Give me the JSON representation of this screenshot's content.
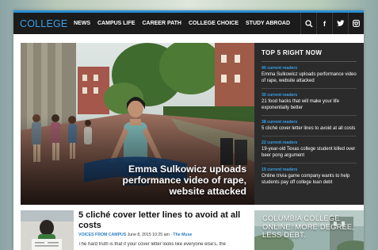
{
  "header": {
    "logo": "COLLEGE",
    "nav": [
      "NEWS",
      "CAMPUS LIFE",
      "CAREER PATH",
      "COLLEGE CHOICE",
      "STUDY ABROAD"
    ],
    "tools": {
      "search_icon": "search-icon",
      "facebook_label": "f",
      "twitter_icon": "twitter-icon",
      "instagram_icon": "instagram-icon"
    }
  },
  "hero": {
    "headline": "Emma Sulkowicz uploads performance video of rape, website attacked"
  },
  "top5": {
    "title": "TOP 5 RIGHT NOW",
    "items": [
      {
        "count": "40 current readers",
        "text": "Emma Sulkowicz uploads performance video of rape, website attacked"
      },
      {
        "count": "30 current readers",
        "text": "21 food hacks that will make your life exponentially better"
      },
      {
        "count": "38 current readers",
        "text": "5 cliché cover letter lines to avoid at all costs"
      },
      {
        "count": "22 current readers",
        "text": "19-year-old Texas college student killed over beer pong argument"
      },
      {
        "count": "19 current readers",
        "text": "Online trivia game company wants to help students pay off college loan debt"
      }
    ]
  },
  "article": {
    "title": "5 cliché cover letter lines to avoid at all costs",
    "section": "VOICES FROM CAMPUS",
    "date": "June 8, 2015 10:25 am",
    "separator": "·",
    "source": "The Muse",
    "excerpt": "The hard truth is that if your cover letter looks like everyone else's, the"
  },
  "ad": {
    "text": "COLUMBIA COLLEGE ONLINE. MORE DEGREE, LESS DEBT."
  },
  "colors": {
    "accent": "#3aa0e8",
    "topbar": "#1b1b1b",
    "panel": "#2b2b2b"
  }
}
